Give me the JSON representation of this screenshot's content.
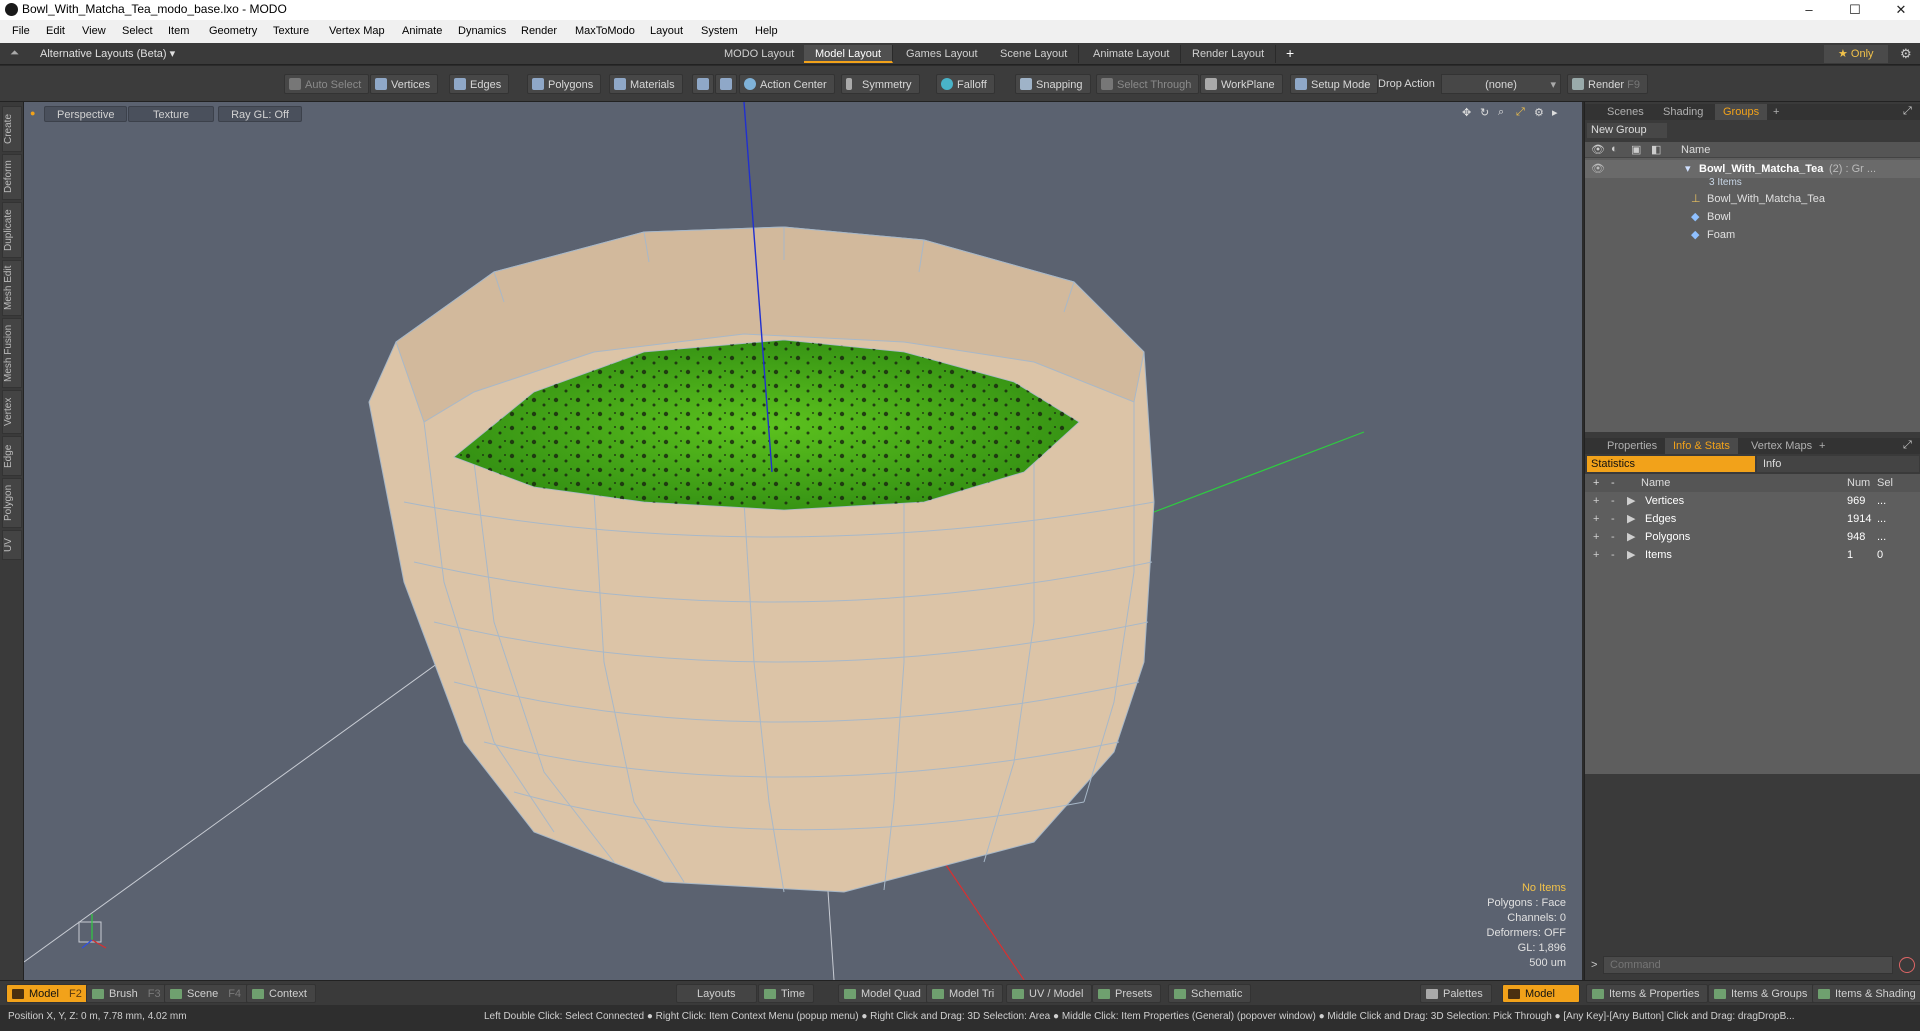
{
  "window": {
    "title": "Bowl_With_Matcha_Tea_modo_base.lxo - MODO",
    "minimize": "–",
    "maximize": "☐",
    "close": "✕"
  },
  "menu": [
    "File",
    "Edit",
    "View",
    "Select",
    "Item",
    "Geometry",
    "Texture",
    "Vertex Map",
    "Animate",
    "Dynamics",
    "Render",
    "MaxToModo",
    "Layout",
    "System",
    "Help"
  ],
  "layoutbar": {
    "alt_layouts": "Alternative Layouts (Beta) ▾",
    "tabs": [
      "MODO Layout",
      "Model Layout",
      "Games Layout",
      "Scene Layout",
      "Animate Layout",
      "Render Layout"
    ],
    "active_tab": "Model Layout",
    "add": "+",
    "only": "★ Only"
  },
  "toolbar": {
    "auto_select": "Auto Select",
    "vertices": "Vertices",
    "edges": "Edges",
    "polygons": "Polygons",
    "materials": "Materials",
    "action_center": "Action Center",
    "symmetry": "Symmetry",
    "falloff": "Falloff",
    "snapping": "Snapping",
    "select_through": "Select Through",
    "workplane": "WorkPlane",
    "setup_mode": "Setup Mode",
    "drop_action": "Drop Action",
    "drop_value": "(none)",
    "render": "Render",
    "render_key": "F9"
  },
  "left_tabs": [
    "Create",
    "Deform",
    "Duplicate",
    "Mesh Edit",
    "Mesh Fusion",
    "Vertex",
    "Edge",
    "Polygon",
    "UV"
  ],
  "viewport": {
    "perspective": "Perspective",
    "texture": "Texture",
    "raygl": "Ray GL: Off",
    "info": {
      "items": "No Items",
      "polygons": "Polygons : Face",
      "channels": "Channels: 0",
      "deformers": "Deformers: OFF",
      "gl": "GL: 1,896",
      "scale": "500 um"
    }
  },
  "scene_panel": {
    "tabs": [
      "Scenes",
      "Shading",
      "Groups"
    ],
    "active_tab": "Groups",
    "add": "+",
    "new_group": "New Group",
    "col_name": "Name",
    "group": {
      "name": "Bowl_With_Matcha_Tea",
      "suffix": "(2) : Gr ...",
      "count": "3 Items"
    },
    "children": [
      "Bowl_With_Matcha_Tea",
      "Bowl",
      "Foam"
    ]
  },
  "props_panel": {
    "tabs": [
      "Properties",
      "Info & Stats",
      "Vertex Maps"
    ],
    "active_tab": "Info & Stats",
    "add": "+",
    "statistics": "Statistics",
    "info": "Info",
    "cols": {
      "name": "Name",
      "num": "Num",
      "sel": "Sel"
    },
    "rows": [
      {
        "name": "Vertices",
        "num": "969",
        "sel": "..."
      },
      {
        "name": "Edges",
        "num": "1914",
        "sel": "..."
      },
      {
        "name": "Polygons",
        "num": "948",
        "sel": "..."
      },
      {
        "name": "Items",
        "num": "1",
        "sel": "0"
      }
    ],
    "command_placeholder": "Command"
  },
  "bottombar": {
    "model": "Model",
    "model_key": "F2",
    "brush": "Brush",
    "brush_key": "F3",
    "scene": "Scene",
    "scene_key": "F4",
    "context": "Context",
    "layouts": "Layouts",
    "time": "Time",
    "model_quad": "Model Quad",
    "model_tri": "Model Tri",
    "uv_model": "UV / Model",
    "presets": "Presets",
    "schematic": "Schematic",
    "palettes": "Palettes",
    "model_right": "Model",
    "items_properties": "Items & Properties",
    "items_groups": "Items & Groups",
    "items_shading": "Items & Shading"
  },
  "statusbar": {
    "position": "Position X, Y, Z:   0 m, 7.78 mm, 4.02 mm",
    "hints": "Left Double Click: Select Connected ● Right Click: Item Context Menu (popup menu) ● Right Click and Drag: 3D Selection: Area ● Middle Click: Item Properties (General) (popover window) ● Middle Click and Drag: 3D Selection: Pick Through ● [Any Key]-[Any Button] Click and Drag: dragDropB..."
  },
  "colors": {
    "accent": "#f2a21a",
    "viewport": "#5b6270",
    "bowl": "#dcc4a7",
    "foam": "#4caf1c"
  }
}
